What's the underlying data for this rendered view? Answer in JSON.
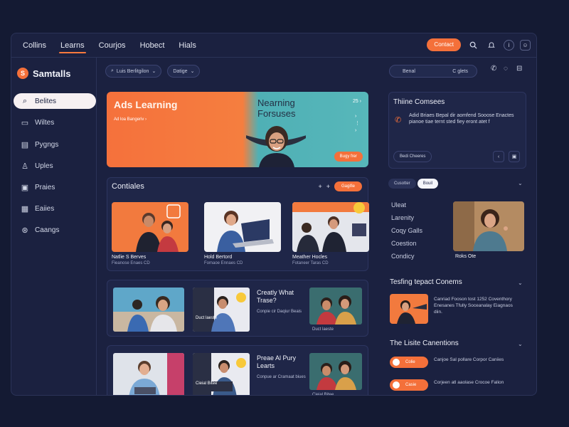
{
  "nav": {
    "tabs": [
      "Collins",
      "Learns",
      "Courjos",
      "Hobect",
      "Hials"
    ],
    "active_tab": 1,
    "cta": "Contact",
    "icons": [
      "search-icon",
      "bell-icon",
      "info-icon",
      "user-icon"
    ]
  },
  "sidebar": {
    "brand": "Samtalls",
    "items": [
      {
        "label": "Belites",
        "icon": "search-icon"
      },
      {
        "label": "Wiltes",
        "icon": "cards-icon"
      },
      {
        "label": "Pygngs",
        "icon": "book-icon"
      },
      {
        "label": "Uples",
        "icon": "person-icon"
      },
      {
        "label": "Praies",
        "icon": "chart-icon"
      },
      {
        "label": "Eaiies",
        "icon": "folder-icon"
      },
      {
        "label": "Caangs",
        "icon": "settings-icon"
      }
    ]
  },
  "filters": {
    "chip1": "Luis Berlitgilon",
    "chip2": "Datige",
    "right_left": "Benal",
    "right_right": "C glets"
  },
  "hero": {
    "title": "Ads Learning",
    "subtitle": "Ad loa Bangeriv  ›",
    "right_title": "Nearning Forsuses",
    "counter": "25 ›",
    "cta": "Bugy frer"
  },
  "continue": {
    "title": "Contiales",
    "button": "Gagifie",
    "cards": [
      {
        "title": "Natlie S Berves",
        "sub": "Fieanose Enaes  CD"
      },
      {
        "title": "Hold Bertord",
        "sub": "Fomaoe Ennaes  CD"
      },
      {
        "title": "Meather Hocles",
        "sub": "Fotaneer Taras  CD"
      }
    ]
  },
  "row1": {
    "question": "Creatly What Trase?",
    "desc": "Conpie cir Daqiur Beais",
    "cap": "Duct laeste"
  },
  "row2": {
    "question": "Preae Al Pury Learts",
    "desc": "Conpue ar Cramaat biues",
    "cap": "Cieial Bitee"
  },
  "right": {
    "panel_title": "Thiine Comsees",
    "panel_body": "Adid Briaes Bepal dir aomfend Sooose Enactes pianoe tiae ternt sted fiey eront atet f",
    "panel_btn": "Bedi Cheeres",
    "seg": [
      "Cusotter",
      "Bouil"
    ],
    "list": [
      "Uleat",
      "Larenity",
      "Coqy Galls",
      "Coestion",
      "Condicy"
    ],
    "img_caption": "Roks Ote",
    "section2": "Tesfing tepact Conems",
    "section2_text": "Canriad Fooson tost 1252 Coventhory Enesanes Tfully Soceanalay Eiagnaos diin.",
    "section3": "The Lisite Canentions",
    "item1_pill": "Colie",
    "item1_text": "Canjoe Sal pollare Corpor Caniies",
    "item2_pill": "Casie",
    "item2_text": "Corjeen atl aaolase Crocoe Falion"
  }
}
